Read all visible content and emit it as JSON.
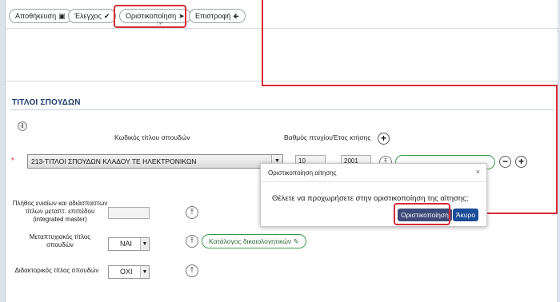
{
  "toolbar": {
    "save_label": "Αποθήκευση",
    "check_label": "Έλεγχος",
    "finalize_label": "Οριστικοποίηση",
    "back_label": "Επιστροφή"
  },
  "section": {
    "title": "ΤΙΤΛΟΙ ΣΠΟΥΔΩΝ",
    "info_label": "i"
  },
  "columns": {
    "title_code": "Κωδικός τίτλου σπουδών",
    "grade": "Βαθμός πτυχίου",
    "year": "Έτος κτήσης"
  },
  "row": {
    "required_mark": "*",
    "selected_title": "213-ΤΙΤΛΟΙ ΣΠΟΥΔΩΝ ΚΛΑΔΟΥ ΤΕ ΗΛΕΚΤΡΟΝΙΚΩΝ",
    "grade_value": "10",
    "year_value": "2001"
  },
  "fields": {
    "integrated_master_label": "Πλήθος ενιαίων και αδιάσπαστων τίτλων μεταπτ. επιπέδου (integrated master)",
    "postgrad_label": "Μεταπτυχιακός τίτλος σπουδών",
    "postgrad_value": "ΝΑΙ",
    "doctoral_label": "Διδακτορικός τίτλος σπουδών",
    "doctoral_value": "ΟΧΙ",
    "documents_catalog": "Κατάλογος δικαιολογητικών"
  },
  "modal": {
    "title": "Οριστικοποίηση αίτησης",
    "close": "×",
    "message": "Θέλετε να προχωρήσετε στην οριστικοποίηση της αίτησης;",
    "confirm_label": "Οριστικοποίηση",
    "cancel_label": "Άκυρο"
  },
  "colors": {
    "highlight": "#d62b37",
    "title_blue": "#1f3e6b",
    "confirm_bg": "#3c4a78",
    "cancel_bg": "#1b4c97",
    "green_outline": "#3b9a4a"
  }
}
